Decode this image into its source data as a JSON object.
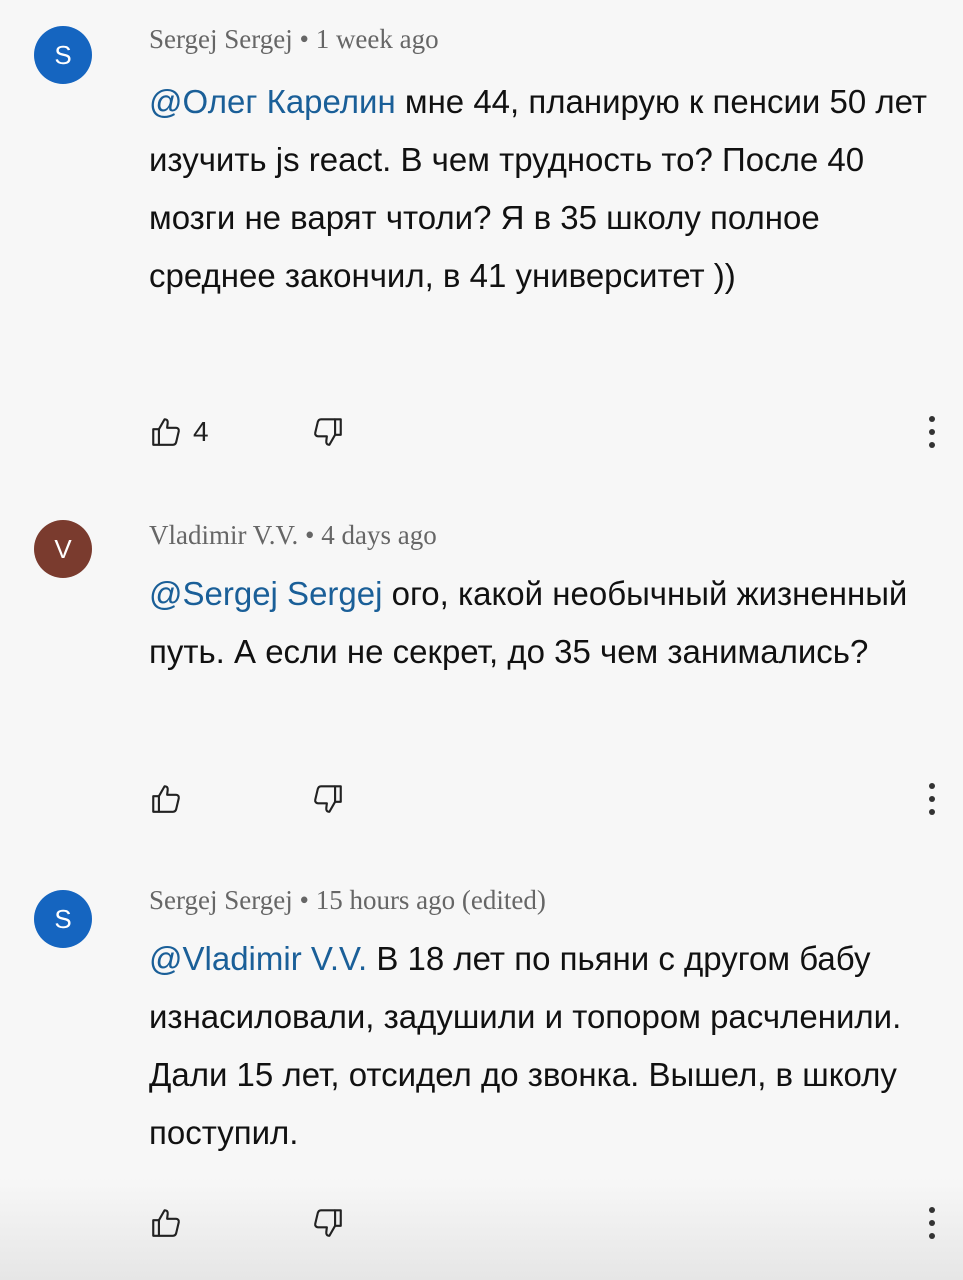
{
  "comments": [
    {
      "avatar_letter": "S",
      "avatar_color": "#1565c0",
      "author": "Sergej Sergej",
      "time": "1 week ago",
      "mention": "@Олег Карелин",
      "text": "мне 44, планирую к пенсии 50 лет изучить js react. В чем трудность то? После 40 мозги не варят чтоли? Я в 35 школу полное среднее закончил, в 41 университет ))",
      "likes": "4"
    },
    {
      "avatar_letter": "V",
      "avatar_color": "#7a3b2e",
      "author": "Vladimir V.V.",
      "time": "4 days ago",
      "mention": "@Sergej Sergej",
      "text": "ого, какой необычный жизненный путь. А если не секрет, до 35 чем занимались?",
      "likes": ""
    },
    {
      "avatar_letter": "S",
      "avatar_color": "#1565c0",
      "author": "Sergej Sergej",
      "time": "15 hours ago (edited)",
      "mention": "@Vladimir V.V.",
      "text": "В 18 лет по пьяни с другом бабу изнасиловали, задушили и топором расчленили. Дали 15 лет, отсидел до звонка. Вышел, в школу поступил.",
      "likes": ""
    }
  ],
  "ui": {
    "separator": "•",
    "icons": {
      "like": "thumbs-up-icon",
      "dislike": "thumbs-down-icon",
      "more": "more-vertical-icon"
    },
    "colors": {
      "mention": "#1a5f98",
      "meta": "#666666",
      "background": "#f7f7f7"
    }
  }
}
